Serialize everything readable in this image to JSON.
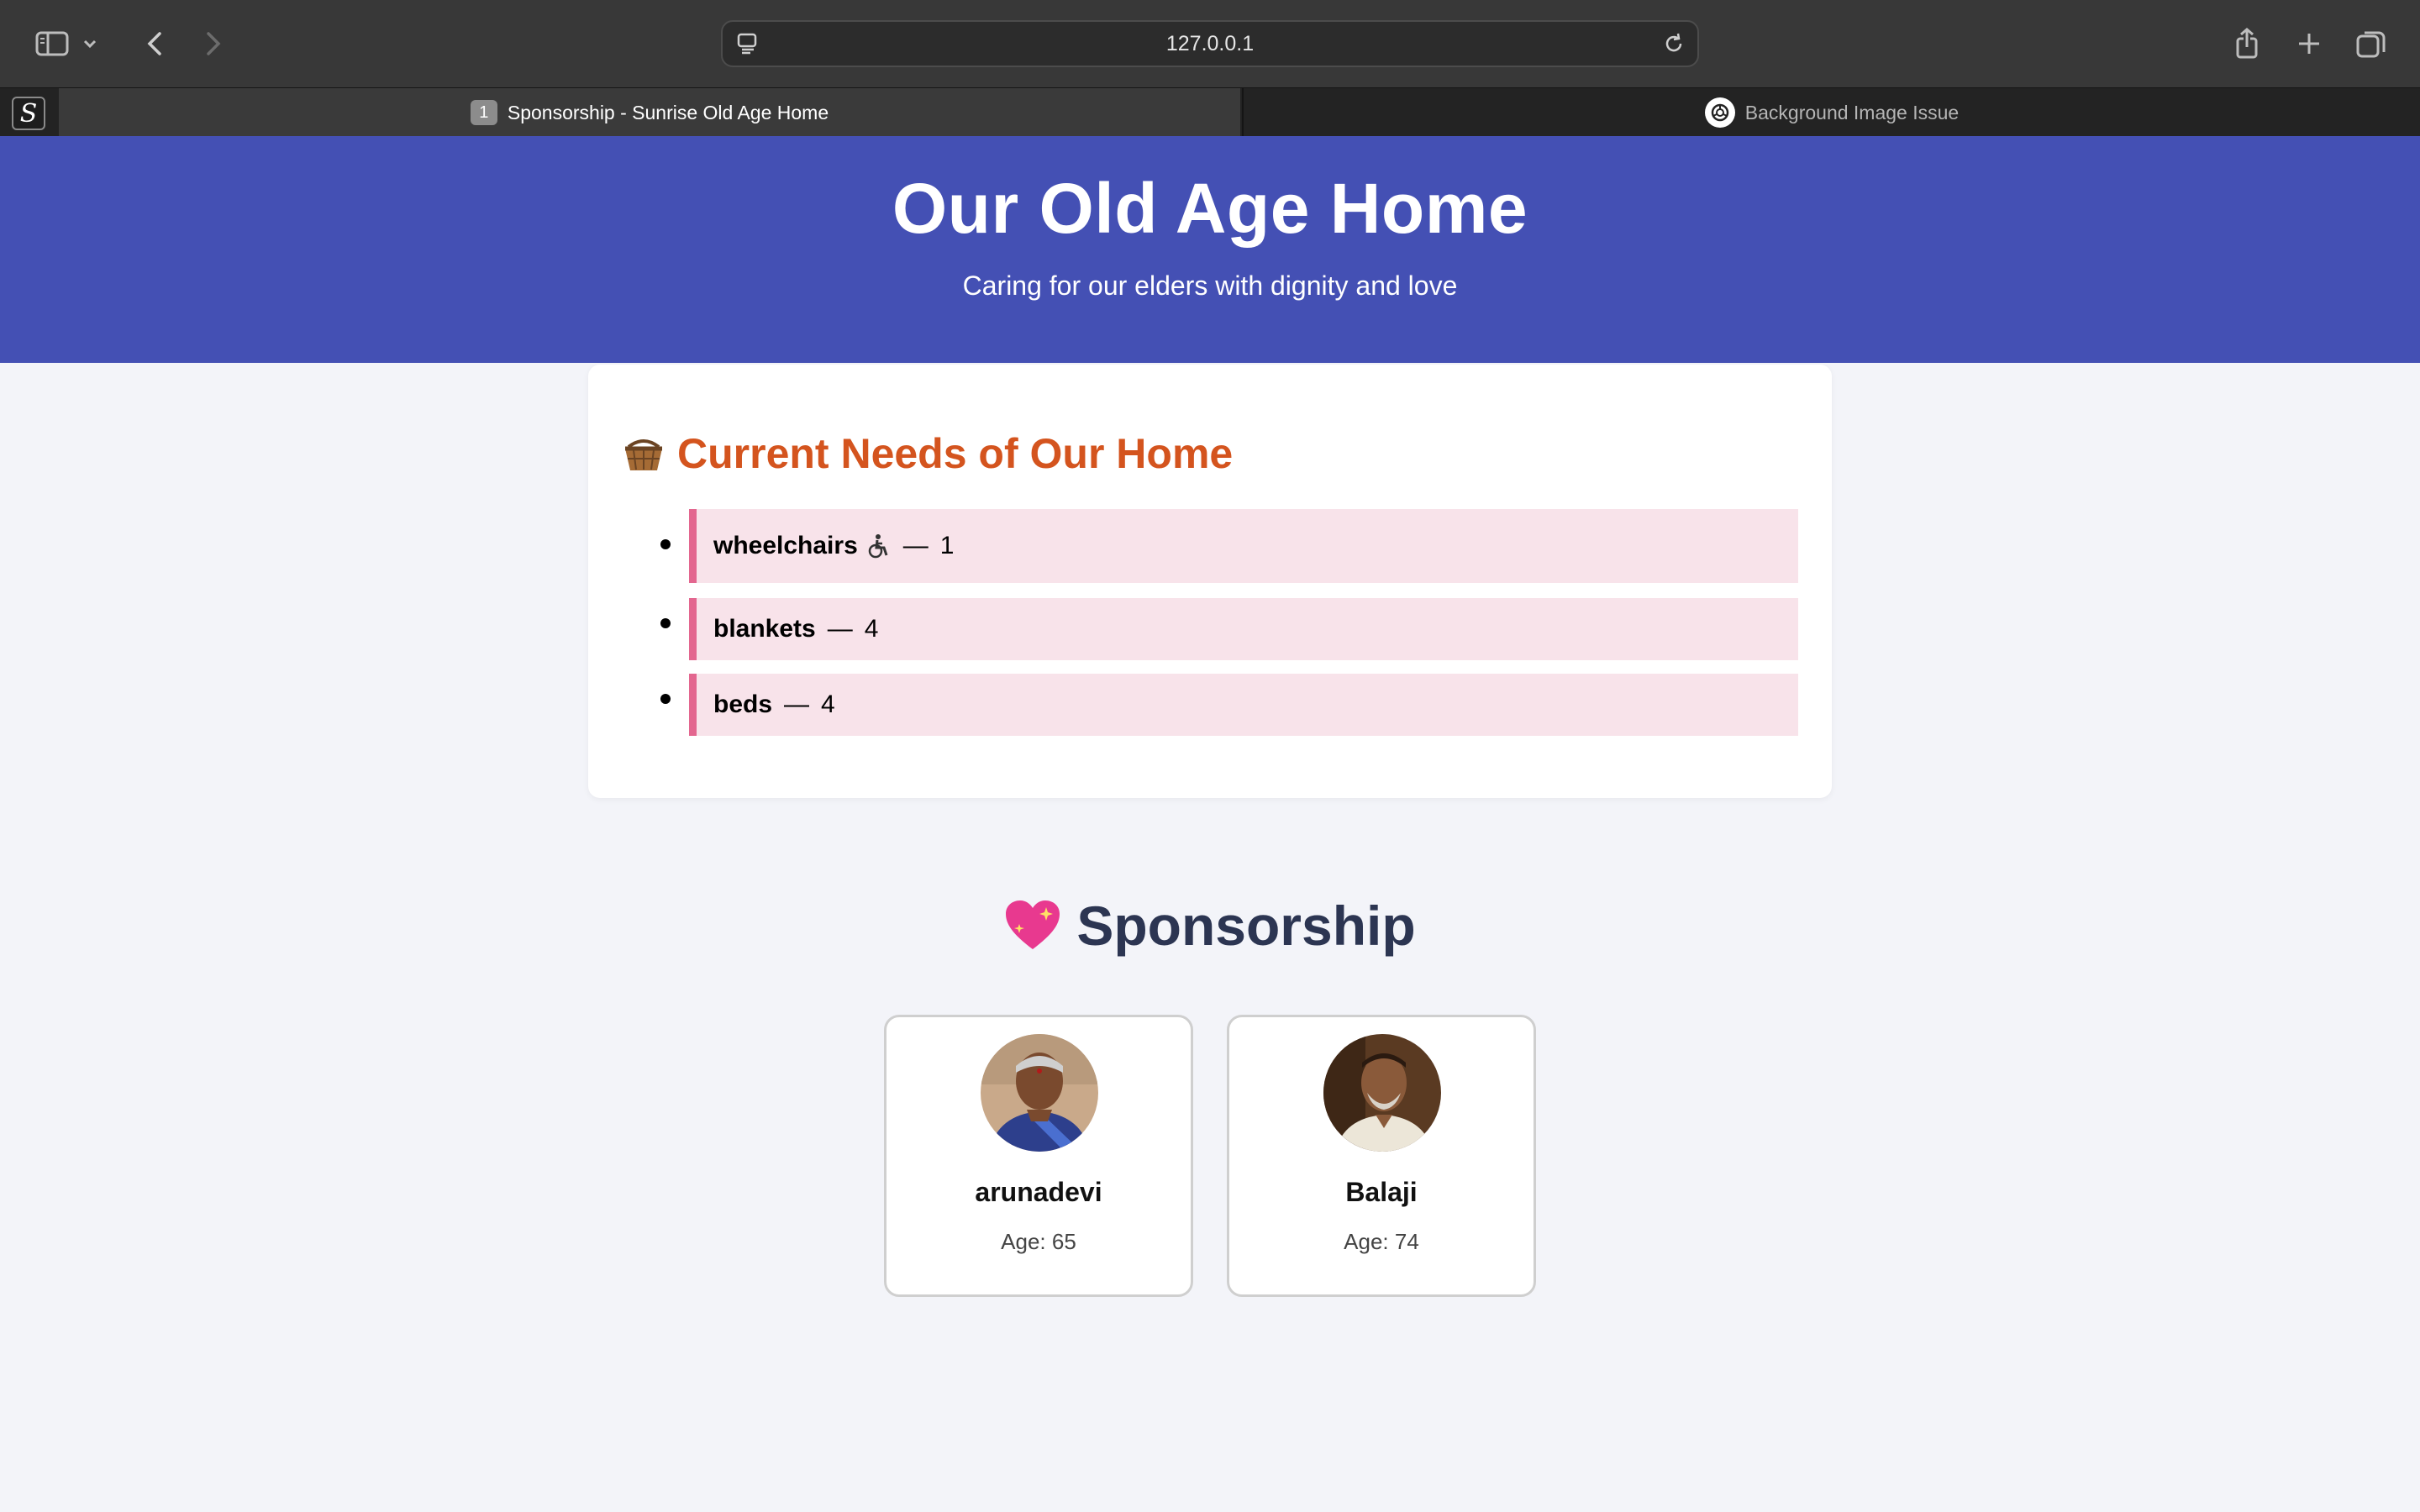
{
  "browser": {
    "url": "127.0.0.1",
    "tabs": [
      {
        "badge": "1",
        "title": "Sponsorship - Sunrise Old Age Home",
        "active": true
      },
      {
        "title": "Background Image Issue",
        "active": false
      }
    ],
    "app_icon_letter": "S"
  },
  "header": {
    "title": "Our Old Age Home",
    "subtitle": "Caring for our elders with dignity and love"
  },
  "needs": {
    "heading": "Current Needs of Our Home",
    "heading_icon": "basket-icon",
    "items": [
      {
        "name": "wheelchairs",
        "separator": "—",
        "count": "1",
        "icon": "wheelchair-icon"
      },
      {
        "name": "blankets",
        "separator": "—",
        "count": "4"
      },
      {
        "name": "beds",
        "separator": "—",
        "count": "4"
      }
    ]
  },
  "sponsorship": {
    "heading": "Sponsorship",
    "heading_icon": "sparkling-heart-icon",
    "people": [
      {
        "name": "arunadevi",
        "age_label": "Age: 65"
      },
      {
        "name": "Balaji",
        "age_label": "Age: 74"
      }
    ]
  },
  "colors": {
    "header_bg": "#4450b4",
    "needs_heading": "#d4541e",
    "need_item_bg": "#f8e3ea",
    "need_item_border": "#e3668f",
    "page_bg": "#f3f4f9"
  }
}
